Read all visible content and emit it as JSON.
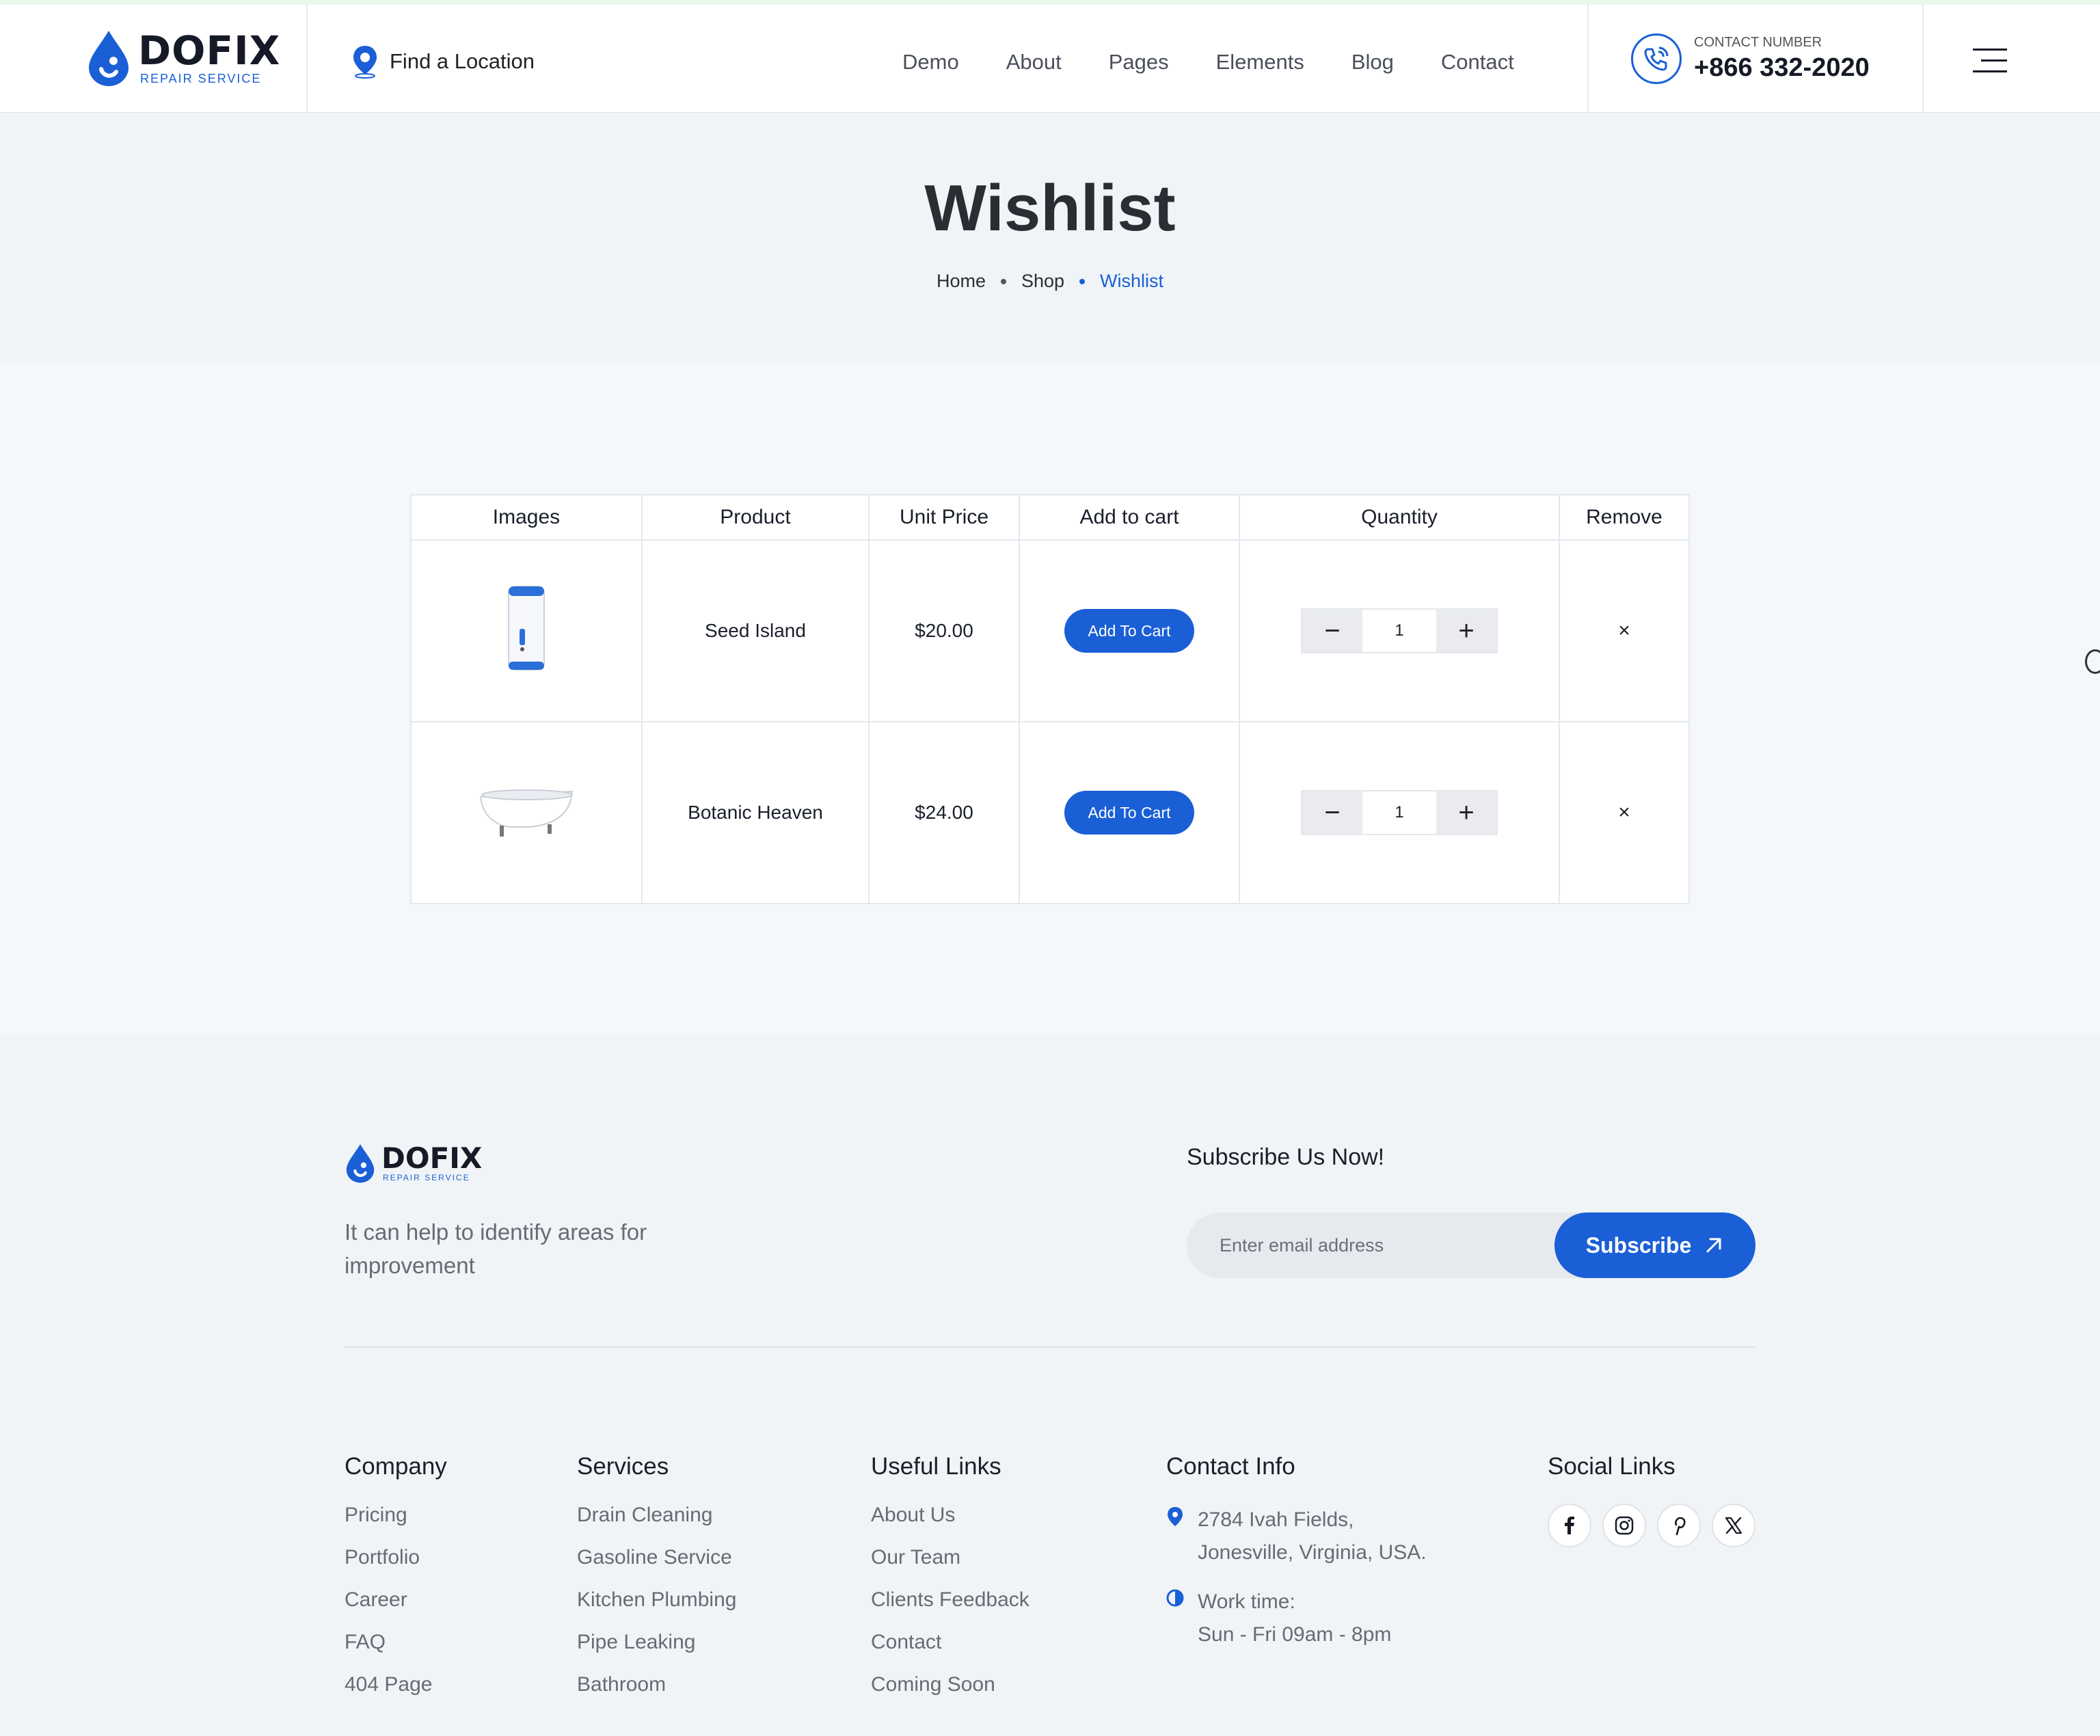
{
  "brand": {
    "name": "DOFIX",
    "tagline": "REPAIR SERVICE"
  },
  "header": {
    "find_location": "Find a Location",
    "nav": [
      "Demo",
      "About",
      "Pages",
      "Elements",
      "Blog",
      "Contact"
    ],
    "contact_label": "CONTACT NUMBER",
    "contact_number": "+866 332-2020"
  },
  "page": {
    "title": "Wishlist",
    "breadcrumb": [
      "Home",
      "Shop",
      "Wishlist"
    ]
  },
  "table": {
    "headers": [
      "Images",
      "Product",
      "Unit Price",
      "Add to cart",
      "Quantity",
      "Remove"
    ],
    "rows": [
      {
        "product": "Seed Island",
        "price": "$20.00",
        "cart_label": "Add To Cart",
        "qty": "1",
        "remove": "×"
      },
      {
        "product": "Botanic Heaven",
        "price": "$24.00",
        "cart_label": "Add To Cart",
        "qty": "1",
        "remove": "×"
      }
    ],
    "minus": "−",
    "plus": "+"
  },
  "footer": {
    "description": "It can help to identify areas for improvement",
    "subscribe_heading": "Subscribe Us Now!",
    "email_placeholder": "Enter email address",
    "subscribe_button": "Subscribe",
    "columns": {
      "company": {
        "title": "Company",
        "links": [
          "Pricing",
          "Portfolio",
          "Career",
          "FAQ",
          "404 Page"
        ]
      },
      "services": {
        "title": "Services",
        "links": [
          "Drain Cleaning",
          "Gasoline Service",
          "Kitchen Plumbing",
          "Pipe Leaking",
          "Bathroom"
        ]
      },
      "useful": {
        "title": "Useful Links",
        "links": [
          "About Us",
          "Our Team",
          "Clients Feedback",
          "Contact",
          "Coming Soon"
        ]
      }
    },
    "contact_info": {
      "title": "Contact Info",
      "address_line1": "2784 Ivah Fields,",
      "address_line2": "Jonesville, Virginia, USA.",
      "work_label": "Work time:",
      "work_hours": "Sun - Fri 09am - 8pm"
    },
    "social_title": "Social Links",
    "social_icons": [
      "facebook-icon",
      "instagram-icon",
      "pinterest-icon",
      "x-icon"
    ]
  },
  "colors": {
    "accent": "#1a5fd6",
    "text": "#1a1f2b",
    "muted": "#666b75",
    "band": "#f0f4f7"
  }
}
